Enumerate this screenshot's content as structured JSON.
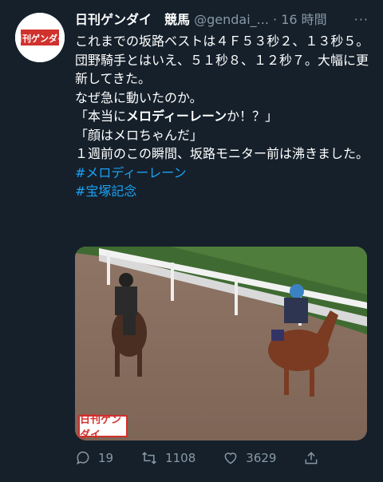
{
  "tweet": {
    "author_name": "日刊ゲンダイ　競馬",
    "handle": "@gendai_...",
    "separator": "·",
    "time": "16 時間",
    "more": "···",
    "lines": [
      "これまでの坂路ベストは４Ｆ５３秒２、１３秒５。",
      "団野騎手とはいえ、５１秒８、１２秒７。大幅に更新してきた。",
      "なぜ急に動いたのか。"
    ],
    "quote1_prefix": "「本当に",
    "quote1_bold": "メロディーレーン",
    "quote1_suffix": "か！？」",
    "quote2": "「顔はメロちゃんだ」",
    "closing": "１週前のこの瞬間、坂路モニター前は沸きました。",
    "hashtags": [
      "#メロディーレーン",
      "#宝塚記念"
    ]
  },
  "avatar": {
    "text": "日刊ゲンダイ"
  },
  "media": {
    "watermark": "日刊ゲンダイ"
  },
  "actions": {
    "reply_count": "19",
    "retweet_count": "1108",
    "like_count": "3629"
  },
  "colors": {
    "background": "#15202b",
    "text": "#ffffff",
    "muted": "#8899a6",
    "link": "#1da1f2",
    "brand_red": "#d0312d"
  },
  "icons": {
    "reply": "reply-icon",
    "retweet": "retweet-icon",
    "like": "heart-icon",
    "share": "share-icon"
  }
}
